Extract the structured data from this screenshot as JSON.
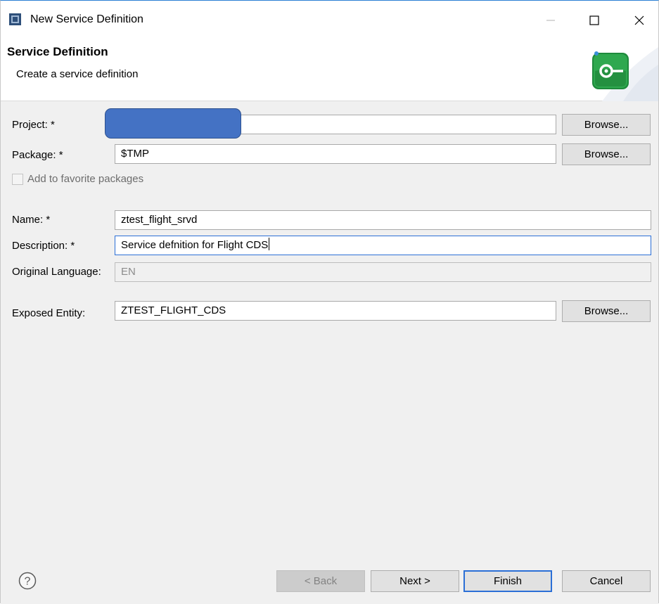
{
  "window": {
    "title": "New Service Definition"
  },
  "header": {
    "title": "Service Definition",
    "subtitle": "Create a service definition",
    "icon": "service-definition-wizard-icon"
  },
  "form": {
    "project_label": "Project: *",
    "project_value": "",
    "package_label": "Package: *",
    "package_value": "$TMP",
    "favorite_label": "Add to favorite packages",
    "name_label": "Name: *",
    "name_value": "ztest_flight_srvd",
    "description_label": "Description: *",
    "description_value": "Service defnition for Flight CDS",
    "language_label": "Original Language:",
    "language_value": "EN",
    "entity_label": "Exposed Entity:",
    "entity_value": "ZTEST_FLIGHT_CDS",
    "browse_label": "Browse..."
  },
  "footer": {
    "back_label": "< Back",
    "next_label": "Next >",
    "finish_label": "Finish",
    "cancel_label": "Cancel"
  },
  "colors": {
    "accent": "#2b6fd6",
    "redaction": "#4472c4",
    "wizard_icon": "#2fa84f"
  }
}
